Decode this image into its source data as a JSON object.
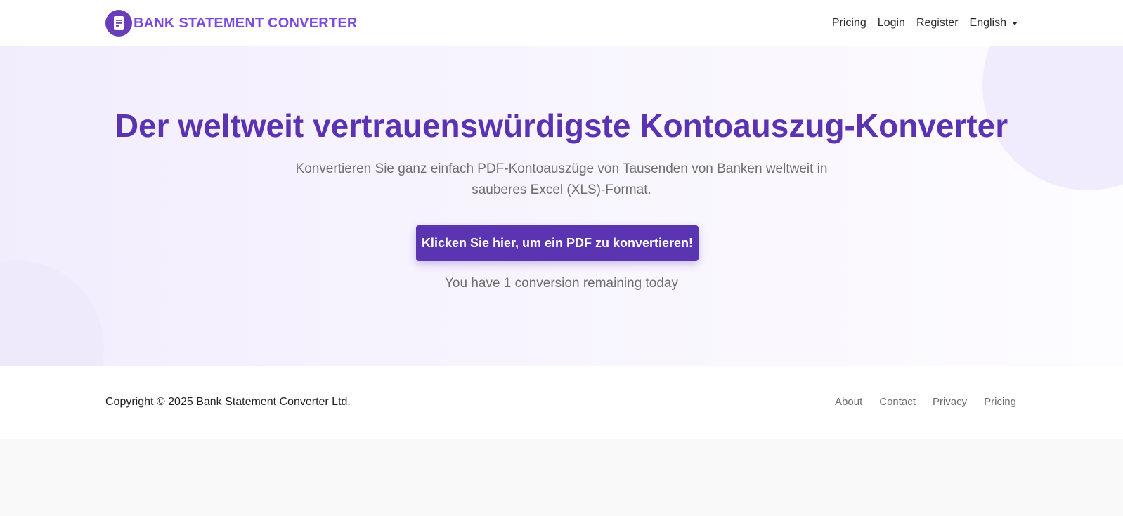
{
  "navbar": {
    "brand_logo_icon": "document-icon",
    "brand_name": "BANK STATEMENT CONVERTER",
    "links": [
      "Pricing",
      "Login",
      "Register"
    ],
    "language": "English"
  },
  "hero": {
    "title": "Der weltweit vertrauenswürdigste Kontoauszug-Konverter",
    "subtitle": "Konvertieren Sie ganz einfach PDF-Kontoauszüge von Tausenden von Banken weltweit in sauberes Excel (XLS)-Format.",
    "cta_label": "Klicken Sie hier, um ein PDF zu konvertieren!",
    "remaining_text": "You have 1 conversion remaining today"
  },
  "footer": {
    "copyright": "Copyright © 2025 Bank Statement Converter Ltd.",
    "links": [
      "About",
      "Contact",
      "Privacy",
      "Pricing"
    ]
  },
  "colors": {
    "primary": "#5b34b1",
    "brand_text": "#7b4ae0",
    "hero_background": "#f5f1fe"
  }
}
